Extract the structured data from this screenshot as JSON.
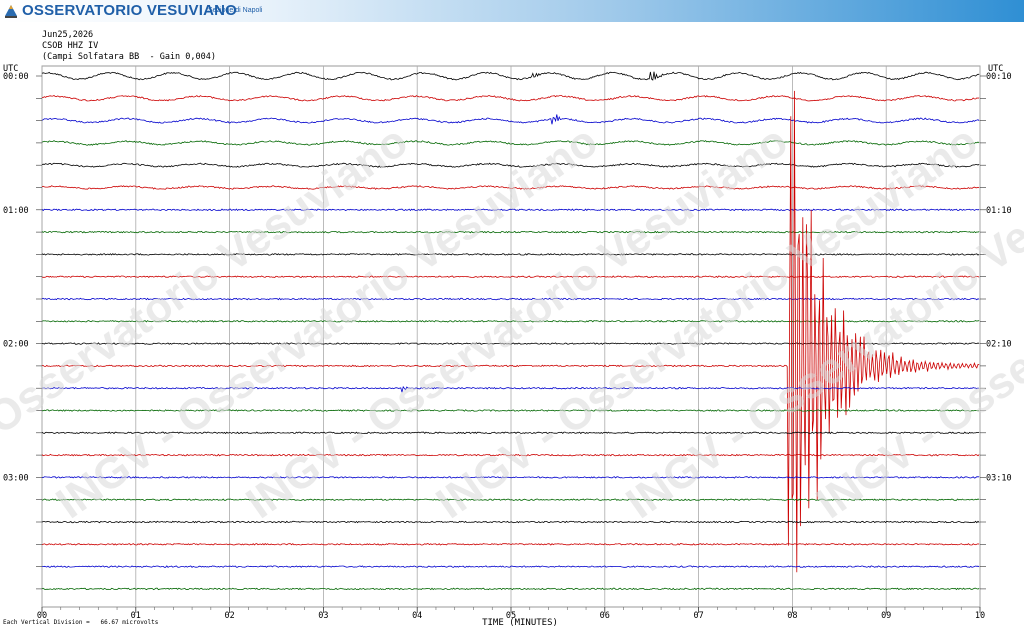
{
  "banner": {
    "title": "OSSERVATORIO VESUVIANO",
    "subtitle": "Sezione di Napoli",
    "logo_text": "INGV",
    "colors": {
      "title": "#1f5fa8",
      "gradient_end": "#2f8fd4"
    }
  },
  "header": {
    "date": "Jun25,2026",
    "station": "CSOB HHZ IV",
    "site": "(Campi Solfatara BB  - Gain 0,004)"
  },
  "watermark": "INGV - Osservatorio Vesuviano",
  "footer": {
    "scale_note": "Each Vertical Division =   66.67 microvolts"
  },
  "chart_data": {
    "type": "line",
    "title": "",
    "xlabel": "TIME (MINUTES)",
    "ylabel": "UTC",
    "right_ylabel": "UTC",
    "x_ticks": [
      "00",
      "01",
      "02",
      "03",
      "04",
      "05",
      "06",
      "07",
      "08",
      "09",
      "10"
    ],
    "xlim": [
      0,
      10
    ],
    "row_count": 24,
    "minutes_per_row": 10,
    "left_time_labels": [
      {
        "row": 0,
        "label": "00:00"
      },
      {
        "row": 6,
        "label": "01:00"
      },
      {
        "row": 12,
        "label": "02:00"
      },
      {
        "row": 18,
        "label": "03:00"
      }
    ],
    "right_time_labels": [
      {
        "row": 0,
        "label": "00:10"
      },
      {
        "row": 6,
        "label": "01:10"
      },
      {
        "row": 12,
        "label": "02:10"
      },
      {
        "row": 18,
        "label": "03:10"
      }
    ],
    "trace_colors": [
      "#000000",
      "#cc0000",
      "#0000cc",
      "#006600"
    ],
    "grid": true,
    "events": [
      {
        "row": 0,
        "minute": 5.25,
        "amplitude": "small",
        "color": "#000000"
      },
      {
        "row": 0,
        "minute": 6.5,
        "amplitude": "medium",
        "color": "#000000"
      },
      {
        "row": 2,
        "minute": 5.45,
        "amplitude": "medium",
        "color": "#0000cc"
      },
      {
        "row": 14,
        "minute": 3.85,
        "amplitude": "small",
        "color": "#0000cc"
      },
      {
        "row": 13,
        "minute": 7.95,
        "end_minute": 10,
        "amplitude": "saturated",
        "color": "#e00000",
        "label": "earthquake"
      }
    ]
  }
}
